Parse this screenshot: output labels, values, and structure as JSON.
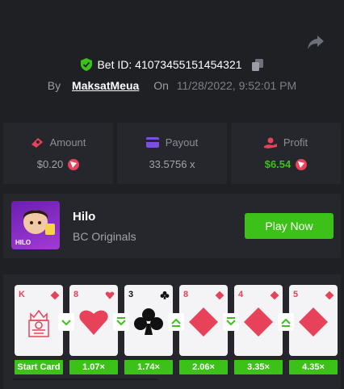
{
  "bet": {
    "label": "Bet ID: 41073455151454321",
    "by_label": "By",
    "username": "MaksatMeua",
    "on_label": "On",
    "datetime": "11/28/2022, 9:52:01 PM"
  },
  "stats": {
    "amount": {
      "label": "Amount",
      "value": "$0.20"
    },
    "payout": {
      "label": "Payout",
      "value": "33.5756 x"
    },
    "profit": {
      "label": "Profit",
      "value": "$6.54"
    }
  },
  "game": {
    "name": "Hilo",
    "provider": "BC Originals",
    "play_label": "Play Now",
    "thumb_text": "HILO"
  },
  "cards": [
    {
      "rank": "K",
      "suit": "diamond",
      "face": true
    },
    {
      "rank": "8",
      "suit": "heart"
    },
    {
      "rank": "3",
      "suit": "club"
    },
    {
      "rank": "8",
      "suit": "diamond"
    },
    {
      "rank": "4",
      "suit": "diamond"
    },
    {
      "rank": "5",
      "suit": "diamond"
    }
  ],
  "guesses": [
    "lower",
    "lower-or-same",
    "higher-or-same",
    "lower-or-same",
    "higher-or-same"
  ],
  "multipliers": [
    "Start Card",
    "1.07×",
    "1.74×",
    "2.06×",
    "3.35×",
    "4.35×"
  ],
  "colors": {
    "accent": "#3bc117",
    "card_red": "#e8425a",
    "bg": "#1e2024",
    "panel": "#25272c"
  }
}
